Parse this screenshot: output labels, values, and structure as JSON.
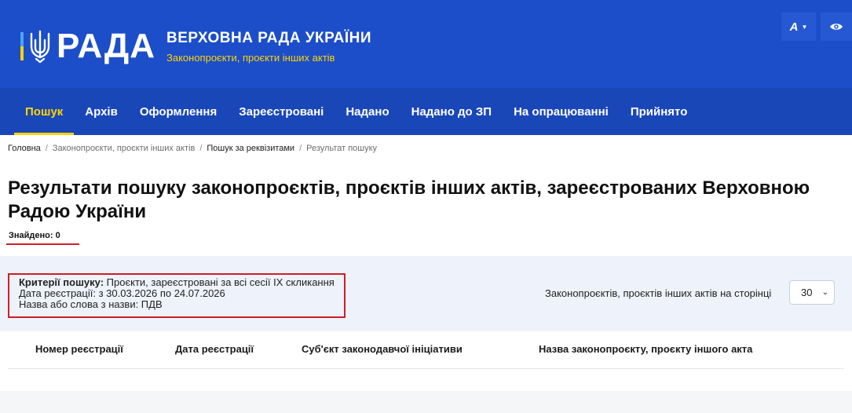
{
  "header": {
    "logo_word": "РАДА",
    "site_title": "ВЕРХОВНА РАДА УКРАЇНИ",
    "site_subtitle": "Законопроєкти, проєкти інших актів",
    "font_tool_label": "A",
    "icons": {
      "font": "font-size-icon",
      "eye": "eye-icon"
    }
  },
  "nav": {
    "items": [
      {
        "label": "Пошук",
        "active": true
      },
      {
        "label": "Архів"
      },
      {
        "label": "Оформлення"
      },
      {
        "label": "Зареєстровані"
      },
      {
        "label": "Надано"
      },
      {
        "label": "Надано до ЗП"
      },
      {
        "label": "На опрацюванні"
      },
      {
        "label": "Прийнято"
      }
    ]
  },
  "breadcrumb": [
    "Головна",
    "Законопроєкти, проєкти інших актів",
    "Пошук за реквізитами",
    "Результат пошуку"
  ],
  "page": {
    "title": "Результати пошуку законопроєктів, проєктів інших актів, зареєстрованих Верховною Радою України",
    "found": "Знайдено: 0"
  },
  "criteria": {
    "label": "Критерії пошуку:",
    "value": "Проєкти, зареєстровані за всі сесії IX скликання",
    "date_line": "Дата реєстрації: з 30.03.2026 по 24.07.2026",
    "name_line": "Назва або слова з назви: ПДВ"
  },
  "per_page": {
    "label": "Законопроєктів, проєктів інших актів на сторінці",
    "value": "30"
  },
  "table": {
    "columns": [
      "Номер реєстрації",
      "Дата реєстрації",
      "Суб'єкт законодавчої ініціативи",
      "Назва законопроєкту, проєкту іншого акта"
    ]
  },
  "colors": {
    "header_bg": "#1c4ec9",
    "nav_bg": "#1a47b8",
    "accent_yellow": "#ffd400",
    "highlight_red": "#d11d2a"
  }
}
